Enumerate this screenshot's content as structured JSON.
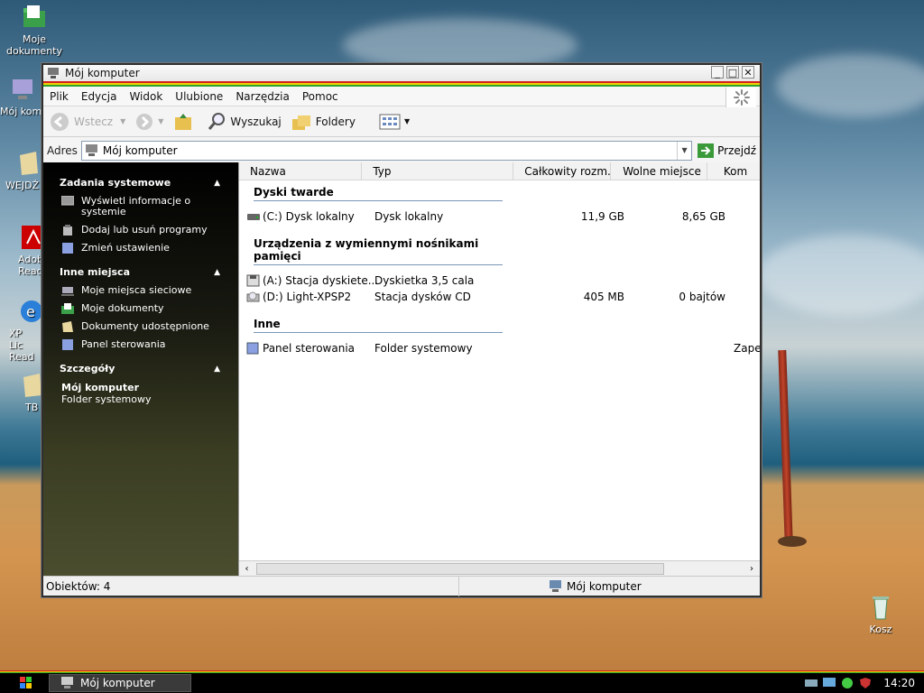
{
  "desktop": {
    "icons": [
      {
        "name": "moje-dokumenty",
        "label": "Moje dokumenty"
      },
      {
        "name": "moj-komputer",
        "label": "Mój kom"
      },
      {
        "name": "wejdz",
        "label": "WEJDŹ"
      },
      {
        "name": "adobe-reader",
        "label": "Adob Read"
      },
      {
        "name": "xp-lic",
        "label": "XP Lic Read"
      },
      {
        "name": "tb",
        "label": "TB"
      },
      {
        "name": "kosz",
        "label": "Kosz"
      }
    ]
  },
  "window": {
    "title": "Mój komputer",
    "controls": {
      "minimize": "_",
      "maximize": "□",
      "close": "✕"
    },
    "menu": [
      "Plik",
      "Edycja",
      "Widok",
      "Ulubione",
      "Narzędzia",
      "Pomoc"
    ],
    "toolbar": {
      "back": "Wstecz",
      "search": "Wyszukaj",
      "folders": "Foldery"
    },
    "address": {
      "label": "Adres",
      "value": "Mój komputer",
      "go": "Przejdź"
    },
    "taskpane": {
      "system_tasks": {
        "title": "Zadania systemowe",
        "items": [
          "Wyświetl informacje o systemie",
          "Dodaj lub usuń programy",
          "Zmień ustawienie"
        ]
      },
      "other_places": {
        "title": "Inne miejsca",
        "items": [
          "Moje miejsca sieciowe",
          "Moje dokumenty",
          "Dokumenty udostępnione",
          "Panel sterowania"
        ]
      },
      "details": {
        "title": "Szczegóły",
        "name": "Mój komputer",
        "type": "Folder systemowy"
      }
    },
    "columns": [
      "Nazwa",
      "Typ",
      "Całkowity rozm...",
      "Wolne miejsce",
      "Kom"
    ],
    "groups": [
      {
        "title": "Dyski twarde",
        "rows": [
          {
            "name": "(C:) Dysk lokalny",
            "type": "Dysk lokalny",
            "total": "11,9 GB",
            "free": "8,65 GB",
            "comment": ""
          }
        ]
      },
      {
        "title": "Urządzenia z wymiennymi nośnikami pamięci",
        "rows": [
          {
            "name": "(A:) Stacja dyskiete...",
            "type": "Dyskietka 3,5 cala",
            "total": "",
            "free": "",
            "comment": ""
          },
          {
            "name": "(D:) Light-XPSP2",
            "type": "Stacja dysków CD",
            "total": "405 MB",
            "free": "0 bajtów",
            "comment": ""
          }
        ]
      },
      {
        "title": "Inne",
        "rows": [
          {
            "name": "Panel sterowania",
            "type": "Folder systemowy",
            "total": "",
            "free": "",
            "comment": "Zape"
          }
        ]
      }
    ],
    "status": {
      "count": "Obiektów: 4",
      "location": "Mój komputer"
    }
  },
  "taskbar": {
    "task": "Mój komputer",
    "clock": "14:20"
  },
  "colors": {
    "accent_red": "#d32020",
    "accent_yellow": "#f0d000",
    "accent_green": "#2fa32f"
  }
}
